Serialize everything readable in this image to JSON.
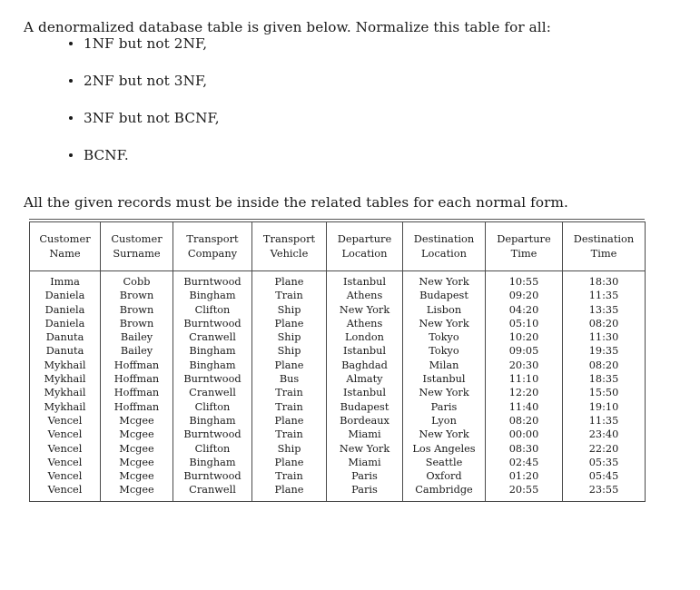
{
  "document": {
    "intro": "A denormalized database table is given below. Normalize this table for all:",
    "bullets": [
      "1NF but not 2NF,",
      "2NF but not 3NF,",
      "3NF but not BCNF,",
      "BCNF."
    ],
    "closing": "All the given records must be inside the related tables for each normal form."
  },
  "table": {
    "headers": [
      {
        "line1": "Customer",
        "line2": "Name"
      },
      {
        "line1": "Customer",
        "line2": "Surname"
      },
      {
        "line1": "Transport",
        "line2": "Company"
      },
      {
        "line1": "Transport",
        "line2": "Vehicle"
      },
      {
        "line1": "Departure",
        "line2": "Location"
      },
      {
        "line1": "Destination",
        "line2": "Location"
      },
      {
        "line1": "Departure",
        "line2": "Time"
      },
      {
        "line1": "Destination",
        "line2": "Time"
      }
    ],
    "rows": [
      [
        "Imma",
        "Cobb",
        "Burntwood",
        "Plane",
        "Istanbul",
        "New York",
        "10:55",
        "18:30"
      ],
      [
        "Daniela",
        "Brown",
        "Bingham",
        "Train",
        "Athens",
        "Budapest",
        "09:20",
        "11:35"
      ],
      [
        "Daniela",
        "Brown",
        "Clifton",
        "Ship",
        "New York",
        "Lisbon",
        "04:20",
        "13:35"
      ],
      [
        "Daniela",
        "Brown",
        "Burntwood",
        "Plane",
        "Athens",
        "New York",
        "05:10",
        "08:20"
      ],
      [
        "Danuta",
        "Bailey",
        "Cranwell",
        "Ship",
        "London",
        "Tokyo",
        "10:20",
        "11:30"
      ],
      [
        "Danuta",
        "Bailey",
        "Bingham",
        "Ship",
        "Istanbul",
        "Tokyo",
        "09:05",
        "19:35"
      ],
      [
        "Mykhail",
        "Hoffman",
        "Bingham",
        "Plane",
        "Baghdad",
        "Milan",
        "20:30",
        "08:20"
      ],
      [
        "Mykhail",
        "Hoffman",
        "Burntwood",
        "Bus",
        "Almaty",
        "Istanbul",
        "11:10",
        "18:35"
      ],
      [
        "Mykhail",
        "Hoffman",
        "Cranwell",
        "Train",
        "Istanbul",
        "New York",
        "12:20",
        "15:50"
      ],
      [
        "Mykhail",
        "Hoffman",
        "Clifton",
        "Train",
        "Budapest",
        "Paris",
        "11:40",
        "19:10"
      ],
      [
        "Vencel",
        "Mcgee",
        "Bingham",
        "Plane",
        "Bordeaux",
        "Lyon",
        "08:20",
        "11:35"
      ],
      [
        "Vencel",
        "Mcgee",
        "Burntwood",
        "Train",
        "Miami",
        "New York",
        "00:00",
        "23:40"
      ],
      [
        "Vencel",
        "Mcgee",
        "Clifton",
        "Ship",
        "New York",
        "Los Angeles",
        "08:30",
        "22:20"
      ],
      [
        "Vencel",
        "Mcgee",
        "Bingham",
        "Plane",
        "Miami",
        "Seattle",
        "02:45",
        "05:35"
      ],
      [
        "Vencel",
        "Mcgee",
        "Burntwood",
        "Train",
        "Paris",
        "Oxford",
        "01:20",
        "05:45"
      ],
      [
        "Vencel",
        "Mcgee",
        "Cranwell",
        "Plane",
        "Paris",
        "Cambridge",
        "20:55",
        "23:55"
      ]
    ]
  },
  "colors": {
    "text": "#1a1a1a",
    "rule": "#4a4a4a",
    "background": "#ffffff"
  }
}
